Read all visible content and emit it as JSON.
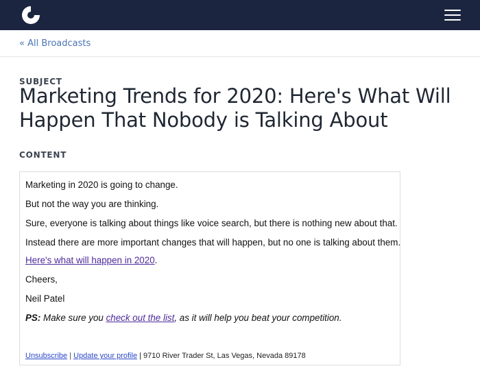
{
  "header": {
    "logo_icon": "convertkit-logo-icon",
    "menu_icon": "hamburger-menu-icon",
    "bg_color": "#1c2540"
  },
  "breadcrumb": {
    "label": "« All Broadcasts"
  },
  "subject": {
    "label": "SUBJECT",
    "title": "Marketing Trends for 2020: Here's What Will Happen That Nobody is Talking About"
  },
  "content": {
    "label": "CONTENT",
    "lines": [
      "Marketing in 2020 is going to change.",
      "But not the way you are thinking.",
      "Sure, everyone is talking about things like voice search, but there is nothing new about that.",
      "Instead there are more important changes that will happen, but no one is talking about them."
    ],
    "link_text": "Here's what will happen in 2020",
    "link_suffix": ".",
    "signoff": "Cheers,",
    "signature": "Neil Patel",
    "ps": {
      "label": "PS:",
      "before": " Make sure you ",
      "link": "check out the list",
      "after": ", as it will help you beat your competition."
    },
    "footer": {
      "unsubscribe": "Unsubscribe",
      "separator": "|",
      "update_profile": "Update your profile",
      "address": "| 9710 River Trader St, Las Vegas, Nevada 89178"
    }
  }
}
